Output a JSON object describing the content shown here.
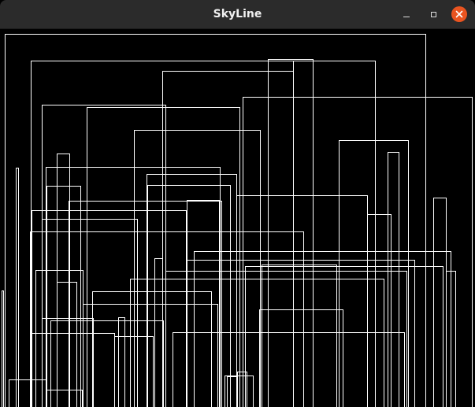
{
  "window": {
    "title": "SkyLine",
    "controls": {
      "minimize_icon": "minimize-icon",
      "maximize_icon": "maximize-icon",
      "close_icon": "close-icon"
    },
    "accent_close": "#e95420"
  },
  "canvas": {
    "background": "#000000",
    "stroke": "#ffffff",
    "buildings": [
      {
        "l": 6,
        "r": 540,
        "h": 474
      },
      {
        "l": 2,
        "r": 4,
        "h": 148
      },
      {
        "l": 20,
        "r": 23,
        "h": 304
      },
      {
        "l": 39,
        "r": 372,
        "h": 440
      },
      {
        "l": 53,
        "r": 210,
        "h": 384
      },
      {
        "l": 340,
        "r": 397,
        "h": 442
      },
      {
        "l": 372,
        "r": 476,
        "h": 440
      },
      {
        "l": 206,
        "r": 372,
        "h": 427
      },
      {
        "l": 308,
        "r": 599,
        "h": 394
      },
      {
        "l": 110,
        "r": 304,
        "h": 381
      },
      {
        "l": 170,
        "r": 330,
        "h": 352
      },
      {
        "l": 430,
        "r": 518,
        "h": 339
      },
      {
        "l": 72,
        "r": 88,
        "h": 322
      },
      {
        "l": 58,
        "r": 279,
        "h": 305
      },
      {
        "l": 492,
        "r": 506,
        "h": 324
      },
      {
        "l": 186,
        "r": 300,
        "h": 296
      },
      {
        "l": 59,
        "r": 102,
        "h": 281
      },
      {
        "l": 187,
        "r": 292,
        "h": 282
      },
      {
        "l": 300,
        "r": 466,
        "h": 269
      },
      {
        "l": 550,
        "r": 566,
        "h": 266
      },
      {
        "l": 87,
        "r": 281,
        "h": 262
      },
      {
        "l": 237,
        "r": 278,
        "h": 263
      },
      {
        "l": 466,
        "r": 496,
        "h": 245
      },
      {
        "l": 40,
        "r": 236,
        "h": 250
      },
      {
        "l": 53,
        "r": 174,
        "h": 239
      },
      {
        "l": 38,
        "r": 385,
        "h": 223
      },
      {
        "l": 246,
        "r": 572,
        "h": 198
      },
      {
        "l": 196,
        "r": 206,
        "h": 189
      },
      {
        "l": 237,
        "r": 526,
        "h": 187
      },
      {
        "l": 45,
        "r": 105,
        "h": 174
      },
      {
        "l": 210,
        "r": 516,
        "h": 173
      },
      {
        "l": 311,
        "r": 562,
        "h": 179
      },
      {
        "l": 332,
        "r": 427,
        "h": 181
      },
      {
        "l": 165,
        "r": 487,
        "h": 163
      },
      {
        "l": 72,
        "r": 97,
        "h": 159
      },
      {
        "l": 117,
        "r": 268,
        "h": 147
      },
      {
        "l": 566,
        "r": 578,
        "h": 173
      },
      {
        "l": 105,
        "r": 276,
        "h": 131
      },
      {
        "l": 329,
        "r": 435,
        "h": 124
      },
      {
        "l": 53,
        "r": 118,
        "h": 113
      },
      {
        "l": 150,
        "r": 158,
        "h": 114
      },
      {
        "l": 64,
        "r": 207,
        "h": 110
      },
      {
        "l": 40,
        "r": 145,
        "h": 94
      },
      {
        "l": 219,
        "r": 513,
        "h": 95
      },
      {
        "l": 145,
        "r": 194,
        "h": 90
      },
      {
        "l": 288,
        "r": 300,
        "h": 39
      },
      {
        "l": 285,
        "r": 321,
        "h": 40
      },
      {
        "l": 11,
        "r": 58,
        "h": 35
      },
      {
        "l": 58,
        "r": 104,
        "h": 22
      },
      {
        "l": 301,
        "r": 313,
        "h": 45
      }
    ]
  }
}
